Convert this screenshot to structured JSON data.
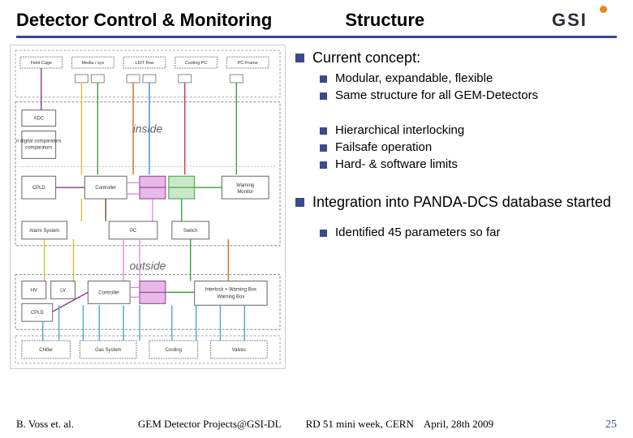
{
  "header": {
    "title_left": "Detector Control & Monitoring",
    "title_right": "Structure",
    "logo_text": "GSI"
  },
  "bullets": {
    "b1": "Current concept:",
    "b1_1": "Modular, expandable, flexible",
    "b1_2": "Same structure for all GEM-Detectors",
    "b1_3": "Hierarchical interlocking",
    "b1_4": "Failsafe operation",
    "b1_5": "Hard- & software limits",
    "b2": "Integration into PANDA-DCS database started",
    "b2_1": "Identified 45 parameters so far"
  },
  "diagram": {
    "label_inside": "inside",
    "label_outside": "outside",
    "boxes": {
      "fieldcage": "Field Cage",
      "media": "Media / sys",
      "ldet": "LD/T flow",
      "cooling": "Cooling PC",
      "pcframe": "PC-Frame",
      "adc": "ADC",
      "digital": "n digital comparators",
      "cpld": "CPLD",
      "controller_in": "Controller",
      "pc": "PC",
      "switch": "Switch",
      "alarm": "Alarm System",
      "hv": "HV",
      "lv": "LV",
      "cpld2": "CPLD",
      "controller_out": "Controller",
      "interlock": "Interlock + Warning Box",
      "chiller": "Chiller",
      "gas": "Gas System",
      "cooling2": "Cooling",
      "valves": "Valves"
    }
  },
  "footer": {
    "author": "B. Voss et. al.",
    "project": "GEM Detector Projects@GSI-DL",
    "event": "RD 51 mini week, CERN",
    "date": "April, 28th 2009",
    "page": "25"
  }
}
